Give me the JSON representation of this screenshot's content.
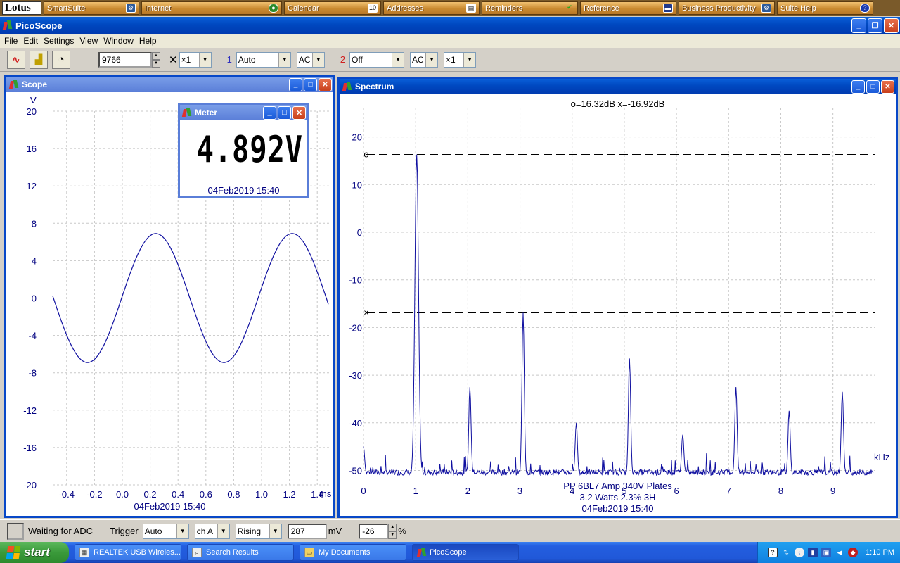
{
  "lotus_bar": {
    "logo": "Lotus",
    "items": [
      {
        "label": "SmartSuite",
        "icon": "smartsuite-icon"
      },
      {
        "label": "Internet",
        "icon": "globe-icon"
      },
      {
        "label": "Calendar",
        "icon": "calendar-icon"
      },
      {
        "label": "Addresses",
        "icon": "address-card-icon"
      },
      {
        "label": "Reminders",
        "icon": "checkmark-icon"
      },
      {
        "label": "Reference",
        "icon": "book-icon"
      },
      {
        "label": "Business Productivity",
        "icon": "productivity-icon"
      },
      {
        "label": "Suite Help",
        "icon": "help-icon"
      }
    ]
  },
  "window": {
    "title": "PicoScope"
  },
  "menu": [
    "File",
    "Edit",
    "Settings",
    "View",
    "Window",
    "Help"
  ],
  "toolbar": {
    "samples_value": "9766",
    "multiplier": "×1",
    "channel1": {
      "label": "1",
      "range": "Auto",
      "coupling": "AC",
      "color": "#3030c0"
    },
    "channel2": {
      "label": "2",
      "range": "Off",
      "coupling": "AC",
      "multiplier": "×1",
      "color": "#d02020"
    }
  },
  "scope": {
    "title": "Scope",
    "y_unit": "V",
    "x_unit": "ms",
    "timestamp": "04Feb2019  15:40",
    "y_ticks": [
      "20",
      "16",
      "12",
      "8",
      "4",
      "0",
      "-4",
      "-8",
      "-12",
      "-16",
      "-20"
    ],
    "x_ticks": [
      "-0.4",
      "-0.2",
      "0.0",
      "0.2",
      "0.4",
      "0.6",
      "0.8",
      "1.0",
      "1.2",
      "1.4"
    ],
    "trace_color": "#1010a0",
    "signal": {
      "amplitude_v": 6.9,
      "period_ms": 0.98,
      "peak_at_ms": 0.24,
      "x_start_ms": -0.5,
      "x_end_ms": 1.48
    }
  },
  "meter": {
    "title": "Meter",
    "reading": "4.892V",
    "timestamp": "04Feb2019  15:40"
  },
  "spectrum": {
    "title": "Spectrum",
    "readout": "o=16.32dB  x=-16.92dB",
    "x_unit": "kHz",
    "y_ticks": [
      "20",
      "10",
      "0",
      "-10",
      "-20",
      "-30",
      "-40",
      "-50"
    ],
    "x_ticks": [
      "0",
      "1",
      "2",
      "3",
      "4",
      "5",
      "6",
      "7",
      "8",
      "9"
    ],
    "marker_o_db": 16.32,
    "marker_x_db": -16.92,
    "marker_o_label": "o",
    "marker_x_label": "×",
    "caption_line1": "PP 6BL7  Amp 340V Plates",
    "caption_line2": "3.2 Watts 2.3% 3H",
    "timestamp": "04Feb2019  15:40",
    "trace_color": "#1010a0"
  },
  "chart_data": [
    {
      "type": "line",
      "title": "Scope",
      "xlabel": "ms",
      "ylabel": "V",
      "xlim": [
        -0.5,
        1.5
      ],
      "ylim": [
        -20,
        20
      ],
      "series": [
        {
          "x": [
            -0.5,
            -0.4,
            -0.3,
            -0.25,
            -0.2,
            -0.1,
            0.0,
            0.1,
            0.2,
            0.25,
            0.3,
            0.4,
            0.5,
            0.6,
            0.7,
            0.75,
            0.8,
            0.9,
            1.0,
            1.1,
            1.2,
            1.22,
            1.3,
            1.4,
            1.48
          ],
          "y": [
            0.8,
            -3.6,
            -6.5,
            -6.9,
            -6.8,
            -4.9,
            -1.5,
            2.9,
            6.3,
            6.9,
            6.8,
            4.6,
            0.9,
            -3.5,
            -6.4,
            -6.9,
            -6.8,
            -5.1,
            -1.8,
            2.6,
            6.3,
            6.9,
            6.5,
            4.2,
            -0.6
          ]
        }
      ]
    },
    {
      "type": "line",
      "title": "Spectrum",
      "xlabel": "kHz",
      "xlim": [
        0,
        9.8
      ],
      "ylim": [
        -52,
        26
      ],
      "series": [
        {
          "x": [
            0,
            0.5,
            1.02,
            1.5,
            2.04,
            2.5,
            3.06,
            3.5,
            4.08,
            4.5,
            5.1,
            5.5,
            6.12,
            6.5,
            7.14,
            7.5,
            8.16,
            8.5,
            9.18,
            9.6
          ],
          "y": [
            -45,
            -50,
            16.3,
            -50,
            -32.5,
            -51,
            -16.9,
            -50,
            -40,
            -51,
            -26.5,
            -51,
            -42.5,
            -50,
            -32.5,
            -50,
            -37.5,
            -49,
            -33.5,
            -50
          ]
        }
      ]
    }
  ],
  "status": {
    "state": "Waiting for ADC",
    "trigger_label": "Trigger",
    "trigger_mode": "Auto",
    "trigger_channel": "ch A",
    "trigger_edge": "Rising",
    "trigger_level": "287",
    "trigger_level_unit": "mV",
    "pre_trigger": "-26",
    "pre_trigger_unit": "%"
  },
  "taskbar": {
    "start": "start",
    "tasks": [
      {
        "label": "REALTEK USB Wireles...",
        "icon": "wireless-icon"
      },
      {
        "label": "Search Results",
        "icon": "search-icon"
      },
      {
        "label": "My Documents",
        "icon": "folder-icon"
      },
      {
        "label": "PicoScope",
        "icon": "picoscope-icon",
        "active": true
      }
    ],
    "clock": "1:10 PM"
  }
}
